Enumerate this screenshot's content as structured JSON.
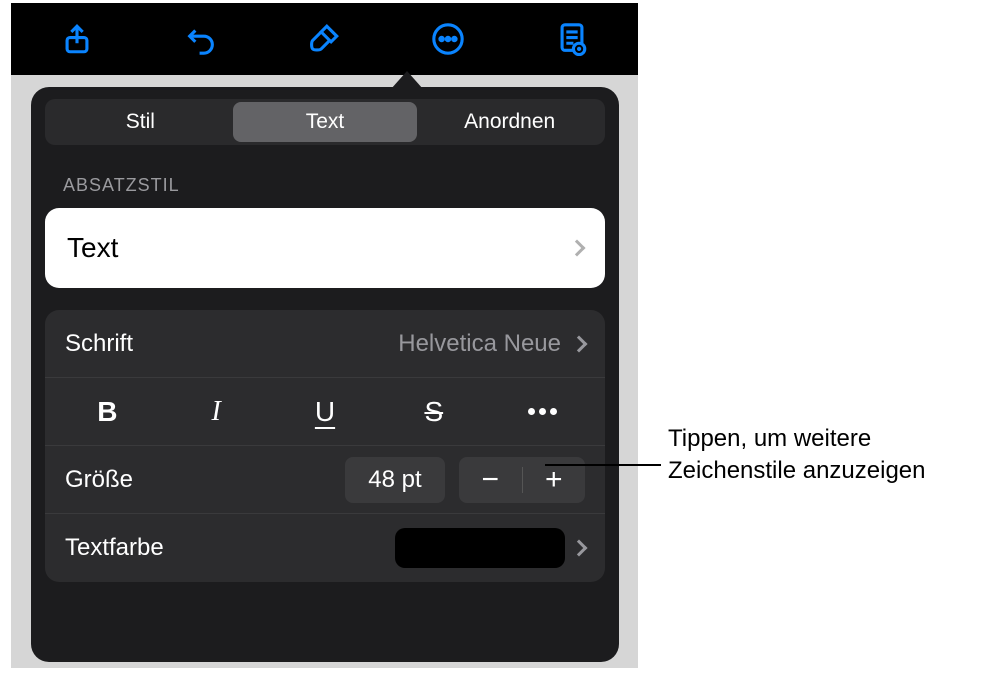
{
  "toolbar": {
    "icons": [
      "share-icon",
      "undo-icon",
      "format-icon",
      "more-icon",
      "document-icon"
    ]
  },
  "tabs": {
    "items": [
      {
        "label": "Stil"
      },
      {
        "label": "Text"
      },
      {
        "label": "Anordnen"
      }
    ],
    "active_index": 1
  },
  "section_label": "ABSATZSTIL",
  "paragraph_style": {
    "name": "Text"
  },
  "font": {
    "label": "Schrift",
    "value": "Helvetica Neue"
  },
  "format_buttons": {
    "bold": "B",
    "italic": "I",
    "underline": "U",
    "strike": "S"
  },
  "size": {
    "label": "Größe",
    "value": "48 pt",
    "minus": "−",
    "plus": "+"
  },
  "text_color": {
    "label": "Textfarbe",
    "value_hex": "#000000"
  },
  "callout": {
    "line1": "Tippen, um weitere",
    "line2": "Zeichenstile anzuzeigen"
  }
}
